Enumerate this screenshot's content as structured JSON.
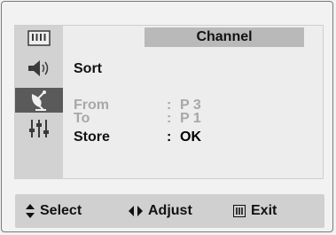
{
  "menu": {
    "title": "Channel",
    "rows": {
      "sort": {
        "label": "Sort"
      },
      "from": {
        "label": "From",
        "sep": ":",
        "value": "P 3",
        "state": "disabled"
      },
      "to": {
        "label": "To",
        "sep": ":",
        "value": "P 1",
        "state": "disabled"
      },
      "store": {
        "label": "Store",
        "sep": ":",
        "value": "OK"
      }
    }
  },
  "sidebar": {
    "items": [
      {
        "icon": "picture-icon",
        "active": false
      },
      {
        "icon": "sound-icon",
        "active": false
      },
      {
        "icon": "antenna-icon",
        "active": true
      },
      {
        "icon": "setup-icon",
        "active": false
      }
    ]
  },
  "footer": {
    "select": {
      "icon": "up-down-arrows-icon",
      "label": "Select"
    },
    "adjust": {
      "icon": "left-right-arrows-icon",
      "label": "Adjust"
    },
    "exit": {
      "icon": "menu-icon",
      "label": "Exit"
    }
  },
  "colors": {
    "active_bg": "#5a5a5a",
    "title_bg": "#b9b9b9",
    "dim_text": "#a8a8a8"
  }
}
